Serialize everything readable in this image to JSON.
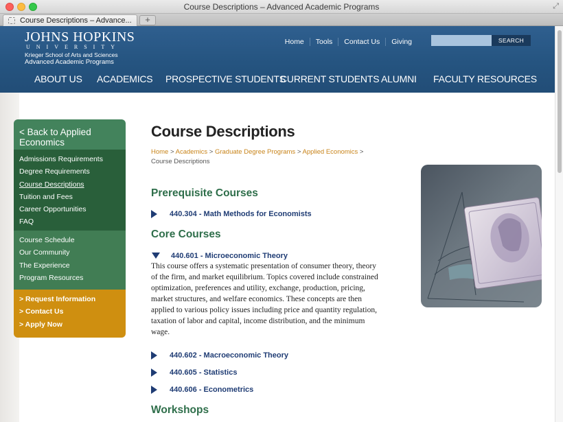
{
  "browser": {
    "window_title": "Course Descriptions – Advanced Academic Programs",
    "tab_title": "Course Descriptions – Advance...",
    "new_tab": "+"
  },
  "header": {
    "logo": {
      "name": "JOHNS HOPKINS",
      "sub": "UNIVERSITY",
      "school": "Krieger School of Arts and Sciences",
      "program": "Advanced Academic Programs"
    },
    "utility_nav": [
      "Home",
      "Tools",
      "Contact Us",
      "Giving"
    ],
    "search": {
      "placeholder": "",
      "button": "SEARCH"
    },
    "main_nav": [
      "ABOUT US",
      "ACADEMICS",
      "PROSPECTIVE STUDENTS",
      "CURRENT STUDENTS",
      "ALUMNI",
      "FACULTY RESOURCES"
    ]
  },
  "sidebar": {
    "back": "< Back to Applied Economics",
    "primary": [
      "Admissions Requirements",
      "Degree Requirements",
      "Course Descriptions",
      "Tuition and Fees",
      "Career Opportunities",
      "FAQ"
    ],
    "current": "Course Descriptions",
    "secondary": [
      "Course Schedule",
      "Our Community",
      "The Experience",
      "Program Resources"
    ],
    "actions": [
      "> Request Information",
      "> Contact Us",
      "> Apply Now"
    ]
  },
  "main": {
    "title": "Course Descriptions",
    "breadcrumb": [
      {
        "label": "Home",
        "link": true
      },
      {
        "label": "Academics",
        "link": true
      },
      {
        "label": "Graduate Degree Programs",
        "link": true
      },
      {
        "label": "Applied Economics",
        "link": true
      },
      {
        "label": "Course Descriptions",
        "link": false
      }
    ],
    "breadcrumb_sep": " > ",
    "sections": {
      "prereq": "Prerequisite Courses",
      "core": "Core Courses",
      "workshops": "Workshops"
    },
    "courses": {
      "c304": "440.304 - Math Methods for Economists",
      "c601": "440.601 - Microeconomic Theory",
      "c602": "440.602 - Macroeconomic Theory",
      "c605": "440.605 - Statistics",
      "c606": "440.606 - Econometrics"
    },
    "c601_description": "This course offers a systematic presentation of consumer theory, theory of the firm, and market equilibrium. Topics covered include constrained optimization, preferences and utility, exchange, production, pricing, market structures, and welfare economics. These concepts are then applied to various policy issues including price and quantity regulation, taxation of labor and capital, income distribution, and the minimum wage."
  }
}
